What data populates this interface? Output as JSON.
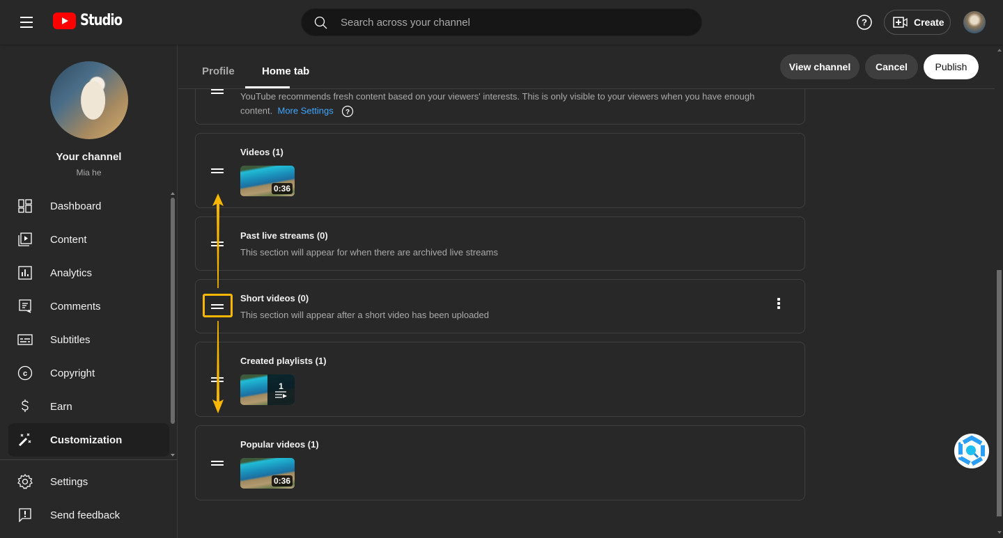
{
  "app": {
    "title": "Studio"
  },
  "topbar": {
    "search_placeholder": "Search across your channel",
    "create_label": "Create"
  },
  "sidebar": {
    "channel_title": "Your channel",
    "channel_name": "Mia he",
    "items": [
      {
        "label": "Dashboard",
        "icon": "dashboard-icon"
      },
      {
        "label": "Content",
        "icon": "content-icon"
      },
      {
        "label": "Analytics",
        "icon": "analytics-icon"
      },
      {
        "label": "Comments",
        "icon": "comments-icon"
      },
      {
        "label": "Subtitles",
        "icon": "subtitles-icon"
      },
      {
        "label": "Copyright",
        "icon": "copyright-icon"
      },
      {
        "label": "Earn",
        "icon": "dollar-icon"
      },
      {
        "label": "Customization",
        "icon": "magic-wand-icon",
        "active": true
      }
    ],
    "bottom_items": [
      {
        "label": "Settings",
        "icon": "gear-icon"
      },
      {
        "label": "Send feedback",
        "icon": "feedback-icon"
      }
    ]
  },
  "main": {
    "tabs": [
      {
        "label": "Profile",
        "active": false
      },
      {
        "label": "Home tab",
        "active": true
      }
    ],
    "actions": {
      "view_channel": "View channel",
      "cancel": "Cancel",
      "publish": "Publish"
    },
    "recommendation_note": {
      "line1": "YouTube recommends fresh content based on your viewers' interests. This is only visible to your viewers when you have enough",
      "line2": "content.",
      "link": "More Settings"
    },
    "sections": [
      {
        "title": "Videos (1)",
        "thumbnail_duration": "0:36"
      },
      {
        "title": "Past live streams (0)",
        "description": "This section will appear for when there are archived live streams"
      },
      {
        "title": "Short videos (0)",
        "description": "This section will appear after a short video has been uploaded",
        "highlighted": true
      },
      {
        "title": "Created playlists (1)",
        "playlist_count": "1"
      },
      {
        "title": "Popular videos (1)",
        "thumbnail_duration": "0:36"
      }
    ]
  },
  "annotation": {
    "color": "#f9b700",
    "meaning": "drag handle to reorder up or down"
  }
}
